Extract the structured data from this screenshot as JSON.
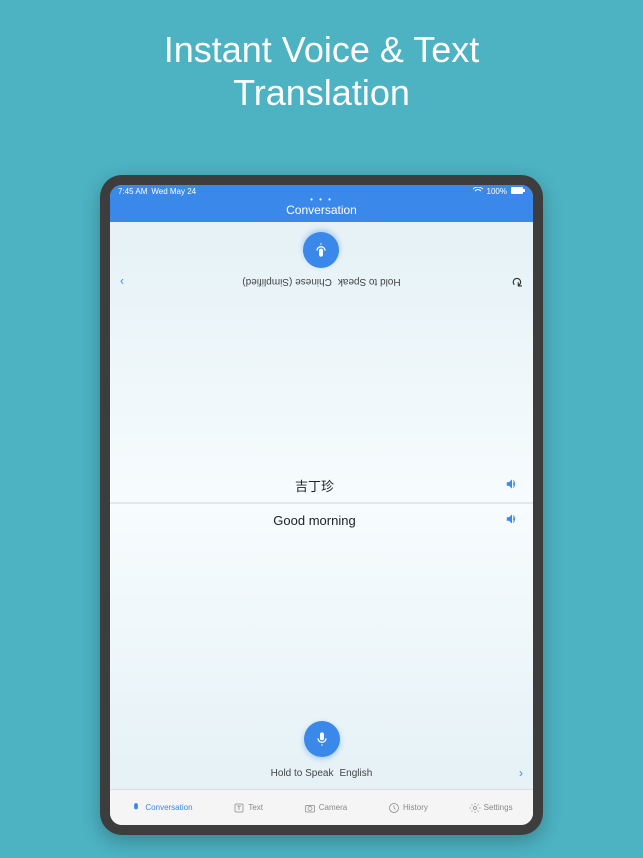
{
  "headline_line1": "Instant Voice & Text",
  "headline_line2": "Translation",
  "statusbar": {
    "time": "7:45 AM",
    "date": "Wed May 24",
    "battery": "100%"
  },
  "navbar": {
    "title": "Conversation"
  },
  "top": {
    "hold_label": "Hold to Speak",
    "language": "Chinese (Simplified)"
  },
  "translation": {
    "target_text": "吉丁珍",
    "source_text": "Good morning"
  },
  "bottom": {
    "hold_label": "Hold to Speak",
    "language": "English"
  },
  "tabs": {
    "conversation": "Conversation",
    "text": "Text",
    "camera": "Camera",
    "history": "History",
    "settings": "Settings"
  }
}
